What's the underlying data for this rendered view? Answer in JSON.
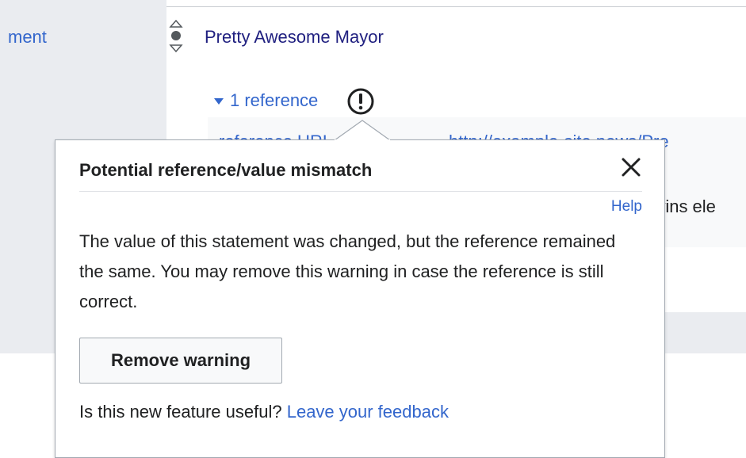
{
  "left_column": {
    "label": "ment"
  },
  "statement": {
    "value": "Pretty Awesome Mayor",
    "references_toggle": "1 reference",
    "warning_icon": "exclamation-circle-icon"
  },
  "reference": {
    "property": "reference URL",
    "url": "http://example-site.news/Pre",
    "title_fragment": "r wins ele"
  },
  "popup": {
    "title": "Potential reference/value mismatch",
    "close_icon": "close-icon",
    "help_label": "Help",
    "body": "The value of this statement was changed, but the reference remained the same. You may remove this warning in case the reference is still correct.",
    "remove_button": "Remove warning",
    "feedback_prompt": "Is this new feature useful?",
    "feedback_link": "Leave your feedback"
  },
  "colors": {
    "link": "#3366cc",
    "value_link": "#202080",
    "text": "#202122",
    "panel_gray": "#eaecf0",
    "reference_bg": "#f8f9fa",
    "border": "#a2a9b1"
  }
}
